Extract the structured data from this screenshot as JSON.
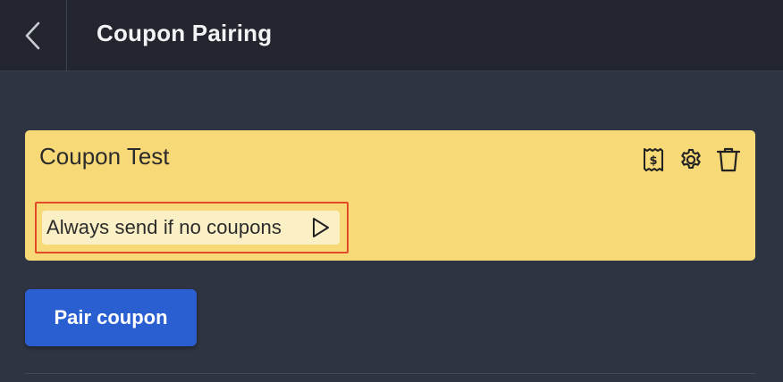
{
  "header": {
    "title": "Coupon Pairing",
    "back_icon": "chevron-left-icon"
  },
  "card": {
    "title": "Coupon Test",
    "background_color": "#f8d978",
    "icons": [
      "receipt-dollar-icon",
      "gear-icon",
      "trash-icon"
    ],
    "condition_label": "Always send if no coupons",
    "condition_icon": "play-icon",
    "highlight_color": "#e24a2a"
  },
  "actions": {
    "pair_label": "Pair coupon",
    "pair_color": "#2a5fd2"
  }
}
